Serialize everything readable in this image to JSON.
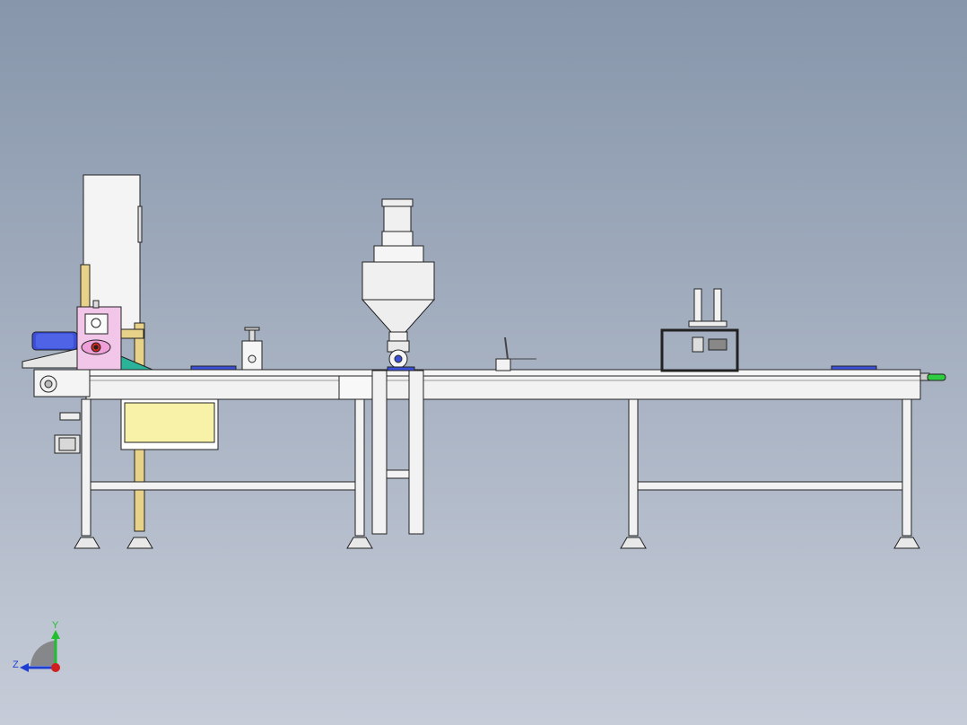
{
  "viewport": {
    "background_top": "#8796ab",
    "background_bottom": "#c6ccd8"
  },
  "model": {
    "components": [
      "frame-legs",
      "conveyor-belt",
      "left-feeder-unit",
      "control-cabinet",
      "motor",
      "auger-filler-hopper",
      "pressing-station",
      "drive-handwheel",
      "adjustable-feet"
    ],
    "colors": {
      "frame": "#f2f2f2",
      "outline": "#222222",
      "pink_panel": "#f2c6e8",
      "motor_blue": "#3b4fd8",
      "yellow_panel": "#f7f2a8",
      "teal_guard": "#2bb39a",
      "wood_post": "#e8d28a",
      "handwheel": "#2ecc40",
      "accent_red": "#d9261c"
    }
  },
  "triad": {
    "y_label": "Y",
    "z_label": "Z",
    "y_color": "#1fbf2f",
    "z_color": "#1f3fd0",
    "x_color": "#d01f1f"
  }
}
